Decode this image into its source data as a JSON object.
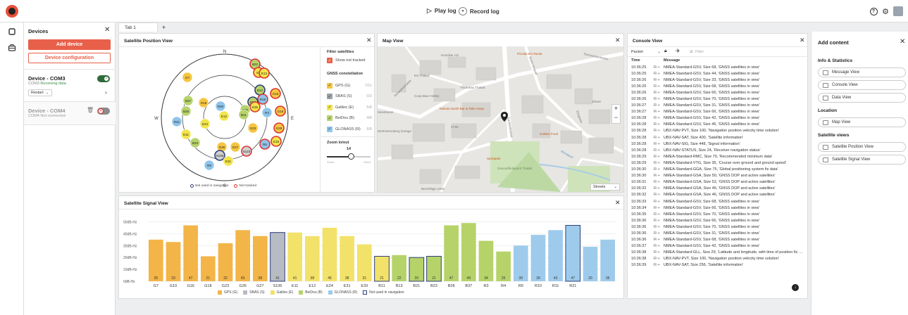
{
  "topbar": {
    "play_log": "Play log",
    "record_log": "Record log",
    "help_icon": "?",
    "settings_icon": "⚙"
  },
  "devices": {
    "title": "Devices",
    "add_device": "Add device",
    "device_configuration": "Device configuration",
    "list": [
      {
        "name": "Device - COM3",
        "port": "COM3",
        "status": "Receiving data",
        "enabled": true,
        "restart": "Restart"
      },
      {
        "name": "Device - COM4",
        "port": "COM4",
        "status": "Not connected",
        "enabled": false
      }
    ]
  },
  "tabs": [
    {
      "label": "Tab 1"
    }
  ],
  "add_tab": "+",
  "satellite_position": {
    "title": "Satellite Position View",
    "compass": {
      "n": "N",
      "s": "S",
      "e": "E",
      "w": "W"
    },
    "filter_title": "Filter satellites",
    "show_not_tracked": "Show not tracked",
    "constellation_title": "GNSS constellation",
    "constellations": [
      {
        "name": "GPS (G)",
        "count": "7/11",
        "color": "#f5c542",
        "checked": true
      },
      {
        "name": "SBAS (S)",
        "count": "0/2",
        "color": "#9aa0a6",
        "checked": true
      },
      {
        "name": "Galileo (E)",
        "count": "5/8",
        "color": "#f2e44a",
        "checked": true
      },
      {
        "name": "BeiDou (B)",
        "count": "4/8",
        "color": "#b6d36a",
        "checked": true
      },
      {
        "name": "GLONASS (R)",
        "count": "6/8",
        "color": "#8ec4ea",
        "checked": true
      }
    ],
    "zoom_title": "Zoom in/out",
    "zoom_value": "14",
    "zoom_level": 0.55,
    "zoom_min": "World",
    "zoom_max": "Street",
    "legend_not_used": "Not used in navigation",
    "legend_not_tracked": "Not tracked",
    "sats": [
      {
        "id": "B22",
        "c": "#b6d36a",
        "s": "red"
      },
      {
        "id": "E7",
        "c": "#f2e44a",
        "s": "red"
      },
      {
        "id": "E13",
        "c": "#f2e44a",
        "s": "red"
      },
      {
        "id": "G7",
        "c": "#f5c542",
        "s": ""
      },
      {
        "id": "B13",
        "c": "#b6d36a",
        "s": "navy"
      },
      {
        "id": "R19",
        "c": "#8ec4ea",
        "s": "red"
      },
      {
        "id": "G15",
        "c": "#f5c542",
        "s": "red"
      },
      {
        "id": "B21",
        "c": "#b6d36a",
        "s": "navy"
      },
      {
        "id": "E35",
        "c": "#f2e44a",
        "s": "red"
      },
      {
        "id": "B37",
        "c": "#b6d36a",
        "s": ""
      },
      {
        "id": "G18",
        "c": "#f5c542",
        "s": ""
      },
      {
        "id": "R20",
        "c": "#8ec4ea",
        "s": ""
      },
      {
        "id": "B25",
        "c": "#b6d36a",
        "s": ""
      },
      {
        "id": "R4",
        "c": "#8ec4ea",
        "s": ""
      },
      {
        "id": "G16",
        "c": "#f5c542",
        "s": "red"
      },
      {
        "id": "B28",
        "c": "#b6d36a",
        "s": ""
      },
      {
        "id": "E12",
        "c": "#f2e44a",
        "s": ""
      },
      {
        "id": "B11",
        "c": "#b6d36a",
        "s": ""
      },
      {
        "id": "E24",
        "c": "#f2e44a",
        "s": ""
      },
      {
        "id": "R21",
        "c": "#8ec4ea",
        "s": ""
      },
      {
        "id": "G23",
        "c": "#f5c542",
        "s": ""
      },
      {
        "id": "G29",
        "c": "#f5c542",
        "s": "red"
      },
      {
        "id": "E11",
        "c": "#f2e44a",
        "s": ""
      },
      {
        "id": "E19",
        "c": "#f2e44a",
        "s": "red"
      },
      {
        "id": "B23",
        "c": "#b6d36a",
        "s": ""
      },
      {
        "id": "G26",
        "c": "#f5c542",
        "s": ""
      },
      {
        "id": "G27",
        "c": "#f5c542",
        "s": ""
      },
      {
        "id": "S123",
        "c": "#d0d0d0",
        "s": "red"
      },
      {
        "id": "R5",
        "c": "#8ec4ea",
        "s": "red"
      },
      {
        "id": "S136",
        "c": "#d0d0d0",
        "s": "navy"
      },
      {
        "id": "E31",
        "c": "#f2e44a",
        "s": ""
      },
      {
        "id": "R9",
        "c": "#8ec4ea",
        "s": ""
      }
    ]
  },
  "map": {
    "title": "Map View",
    "style": "Streets",
    "zoom_in": "+",
    "zoom_out": "−",
    "labels": [
      "Hunziker AG",
      "Pizzakurier Ruota",
      "Eni Thalwil",
      "Fourneau Thalwil",
      "Coop Bau+Hobby",
      "Mukuta Sushi-Bar & Take-Away",
      "JYSK",
      "Golden Food",
      "Sportpark",
      "Gesundheitspark Thalwil",
      "Beschläge USW",
      "Wohnimmoberg Garage",
      "Tischenloostrasse",
      "Seestrasse",
      "Schwalmstrasse",
      "Zürcherstrasse",
      "Bettenstrasse",
      "Bürobach",
      "Ebnet",
      "Etzgasse"
    ]
  },
  "console": {
    "title": "Console View",
    "packet": "Packet",
    "filter_placeholder": "Filter",
    "col_time": "Time",
    "col_message": "Message",
    "rows": [
      {
        "t": "10:36:25",
        "d": "R⇢",
        "m": "NMEA-Standard-GSV, Size 68, 'GNSS satellites in view'"
      },
      {
        "t": "10:36:25",
        "d": "R⇢",
        "m": "NMEA-Standard-GSV, Size 44, 'GNSS satellites in view'"
      },
      {
        "t": "10:36:26",
        "d": "R⇢",
        "m": "NMEA-Standard-GSV, Size 33, 'GNSS satellites in view'"
      },
      {
        "t": "10:36:26",
        "d": "R⇢",
        "m": "NMEA-Standard-GSV, Size 68, 'GNSS satellites in view'"
      },
      {
        "t": "10:36:26",
        "d": "R⇢",
        "m": "NMEA-Standard-GSV, Size 66, 'GNSS satellites in view'"
      },
      {
        "t": "10:36:26",
        "d": "R⇢",
        "m": "NMEA-Standard-GSV, Size 70, 'GNSS satellites in view'"
      },
      {
        "t": "10:36:27",
        "d": "R⇢",
        "m": "NMEA-Standard-GSV, Size 31, 'GNSS satellites in view'"
      },
      {
        "t": "10:36:27",
        "d": "R⇢",
        "m": "NMEA-Standard-GSV, Size 66, 'GNSS satellites in view'"
      },
      {
        "t": "10:36:28",
        "d": "R⇢",
        "m": "NMEA-Standard-GSV, Size 42, 'GNSS satellites in view'"
      },
      {
        "t": "10:36:28",
        "d": "R⇢",
        "m": "NMEA-Standard-GSV, Size 46, 'GNSS satellites in view'"
      },
      {
        "t": "10:36:28",
        "d": "R⇢",
        "m": "UBX-NAV-PVT, Size 100, 'Navigation position velocity time solution'"
      },
      {
        "t": "10:36:28",
        "d": "R⇢",
        "m": "UBX-NAV-SAT, Size 400, 'Satellite information'"
      },
      {
        "t": "10:36:28",
        "d": "R⇢",
        "m": "UBX-NAV-SIG, Size 448, 'Signal information'"
      },
      {
        "t": "10:36:28",
        "d": "R⇢",
        "m": "UBX-NAV-STATUS, Size 24, 'Receiver navigation status'"
      },
      {
        "t": "10:36:29",
        "d": "R⇢",
        "m": "NMEA-Standard-RMC, Size 70, 'Recommended minimum data'"
      },
      {
        "t": "10:36:29",
        "d": "R⇢",
        "m": "NMEA-Standard-VTG, Size 35, 'Course over ground and ground speed'"
      },
      {
        "t": "10:36:30",
        "d": "R⇢",
        "m": "NMEA-Standard-GGA, Size 75, 'Global positioning system fix data'"
      },
      {
        "t": "10:36:30",
        "d": "R⇢",
        "m": "NMEA-Standard-GSA, Size 50, 'GNSS DOP and active satellites'"
      },
      {
        "t": "10:36:31",
        "d": "R⇢",
        "m": "NMEA-Standard-GSA, Size 52, 'GNSS DOP and active satellites'"
      },
      {
        "t": "10:36:32",
        "d": "R⇢",
        "m": "NMEA-Standard-GSA, Size 46, 'GNSS DOP and active satellites'"
      },
      {
        "t": "10:36:32",
        "d": "R⇢",
        "m": "NMEA-Standard-GSA, Size 46, 'GNSS DOP and active satellites'"
      },
      {
        "t": "10:36:33",
        "d": "R⇢",
        "m": "NMEA-Standard-GSV, Size 68, 'GNSS satellites in view'"
      },
      {
        "t": "10:36:34",
        "d": "R⇢",
        "m": "NMEA-Standard-GSV, Size 66, 'GNSS satellites in view'"
      },
      {
        "t": "10:36:35",
        "d": "R⇢",
        "m": "NMEA-Standard-GSV, Size 70, 'GNSS satellites in view'"
      },
      {
        "t": "10:36:36",
        "d": "R⇢",
        "m": "NMEA-Standard-GSV, Size 66, 'GNSS satellites in view'"
      },
      {
        "t": "10:36:36",
        "d": "R⇢",
        "m": "NMEA-Standard-GSV, Size 70, 'GNSS satellites in view'"
      },
      {
        "t": "10:36:36",
        "d": "R⇢",
        "m": "NMEA-Standard-GSV, Size 31, 'GNSS satellites in view'"
      },
      {
        "t": "10:36:36",
        "d": "R⇢",
        "m": "NMEA-Standard-GSV, Size 68, 'GNSS satellites in view'"
      },
      {
        "t": "10:36:37",
        "d": "R⇢",
        "m": "NMEA-Standard-GSV, Size 42, 'GNSS satellites in view'"
      },
      {
        "t": "10:36:38",
        "d": "R⇢",
        "m": "NMEA-Standard-GLL, Size 29, 'Latitude and longitude, with time of position fix and status'"
      },
      {
        "t": "10:36:38",
        "d": "R⇢",
        "m": "UBX-NAV-PVT, Size 100, 'Navigation position velocity time solution'"
      },
      {
        "t": "10:36:39",
        "d": "R⇢",
        "m": "UBX-NAV-SAT, Size 256, 'Satellite information'"
      }
    ]
  },
  "add_content": {
    "title": "Add content",
    "sections": [
      {
        "title": "Info & Statistics",
        "items": [
          "Message View",
          "Console View",
          "Data View"
        ]
      },
      {
        "title": "Location",
        "items": [
          "Map View"
        ]
      },
      {
        "title": "Satellite views",
        "items": [
          "Satellite Position View",
          "Satellite Signal View"
        ]
      }
    ]
  },
  "chart_data": {
    "type": "bar",
    "title": "Satellite Signal View",
    "ylabel": "",
    "xlabel": "",
    "ylim": [
      0,
      55
    ],
    "yticks": [
      "0dB-Hz",
      "10dB-Hz",
      "20dB-Hz",
      "30dB-Hz",
      "40dB-Hz",
      "50dB-Hz"
    ],
    "categories": [
      "G7",
      "G10",
      "G16",
      "G18",
      "G23",
      "G26",
      "G27",
      "S136",
      "E11",
      "E12",
      "E24",
      "E31",
      "E33",
      "B11",
      "B13",
      "B21",
      "B23",
      "B28",
      "B37",
      "R3",
      "R4",
      "R9",
      "R10",
      "R11",
      "R21"
    ],
    "values": [
      35,
      33,
      47,
      21,
      32,
      43,
      38,
      41,
      41,
      38,
      45,
      38,
      31,
      21,
      22,
      20,
      21,
      47,
      49,
      34,
      25,
      30,
      39,
      43,
      47,
      29,
      35
    ],
    "groups": [
      "GPS",
      "GPS",
      "GPS",
      "GPS",
      "GPS",
      "GPS",
      "GPS",
      "SBAS",
      "Galileo",
      "Galileo",
      "Galileo",
      "Galileo",
      "Galileo",
      "Galileo",
      "BeiDou",
      "BeiDou",
      "BeiDou",
      "BeiDou",
      "BeiDou",
      "BeiDou",
      "BeiDou",
      "GLONASS",
      "GLONASS",
      "GLONASS",
      "GLONASS",
      "GLONASS",
      "GLONASS"
    ],
    "not_used": [
      false,
      false,
      false,
      false,
      false,
      false,
      false,
      true,
      false,
      false,
      false,
      false,
      false,
      true,
      false,
      true,
      true,
      false,
      false,
      false,
      false,
      false,
      false,
      false,
      true,
      false,
      false
    ],
    "group_colors": {
      "GPS": "#f3b548",
      "SBAS": "#b7bcc4",
      "Galileo": "#f2e26a",
      "BeiDou": "#b6d36a",
      "GLONASS": "#9ecbeb"
    },
    "legend": [
      "GPS (G)",
      "SBAS (S)",
      "Galileo (E)",
      "BeiDou (B)",
      "GLONASS (R)",
      "Not used in navigation"
    ]
  }
}
